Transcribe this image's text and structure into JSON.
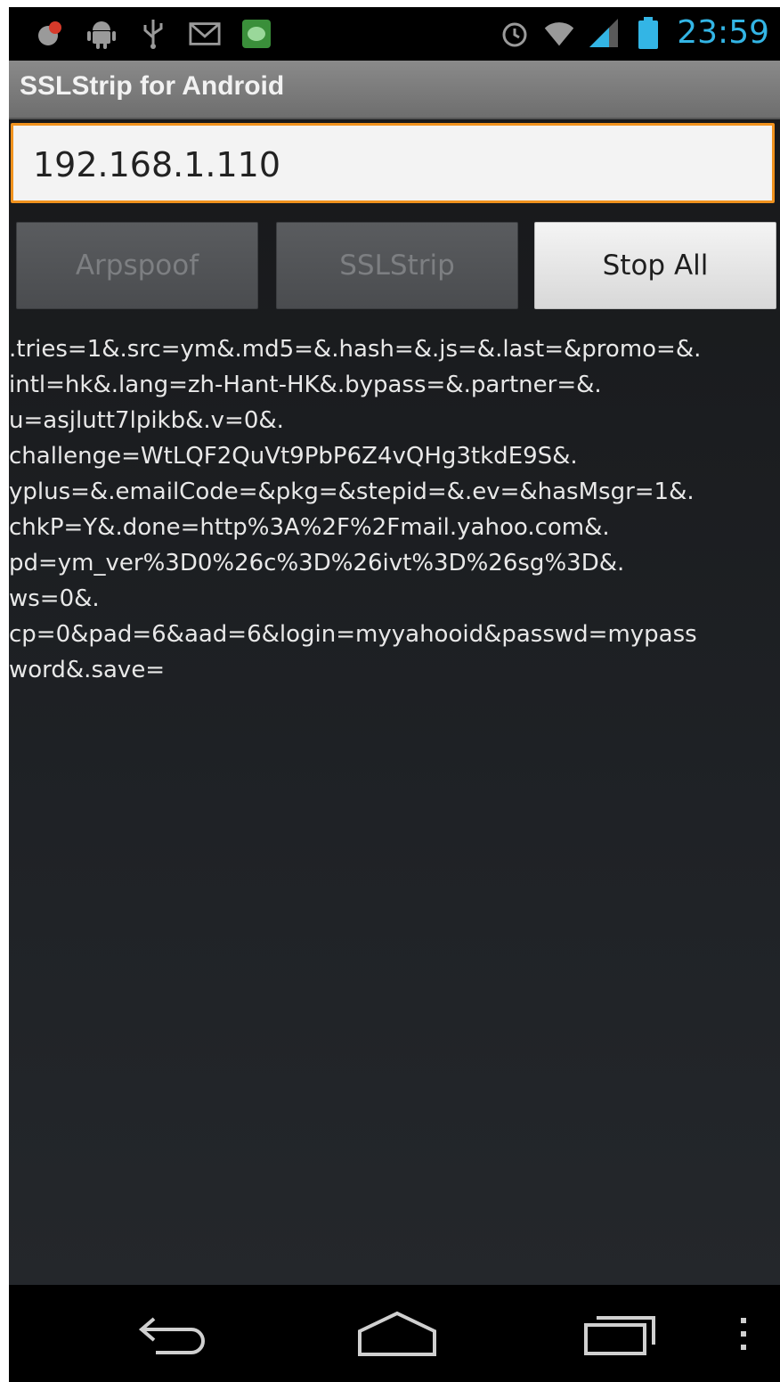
{
  "status_bar": {
    "time": "23:59",
    "time_color": "#33b5e5",
    "left_icons": [
      "alert-icon",
      "android-icon",
      "usb-icon",
      "gmail-icon",
      "chat-icon"
    ],
    "right_icons": [
      "alarm-icon",
      "wifi-icon",
      "signal-icon",
      "battery-icon"
    ]
  },
  "action_bar": {
    "title": "SSLStrip for Android"
  },
  "ip_field": {
    "value": "192.168.1.110",
    "accent": "#f0921e"
  },
  "buttons": {
    "arpspoof": "Arpspoof",
    "sslstrip": "SSLStrip",
    "stop_all": "Stop All"
  },
  "log_lines": [
    ".tries=1&.src=ym&.md5=&.hash=&.js=&.last=&promo=&.",
    "intl=hk&.lang=zh-Hant-HK&.bypass=&.partner=&.",
    "u=asjlutt7lpikb&.v=0&.",
    "challenge=WtLQF2QuVt9PbP6Z4vQHg3tkdE9S&.",
    "yplus=&.emailCode=&pkg=&stepid=&.ev=&hasMsgr=1&.",
    "chkP=Y&.done=http%3A%2F%2Fmail.yahoo.com&.",
    "pd=ym_ver%3D0%26c%3D%26ivt%3D%26sg%3D&.",
    "ws=0&.",
    "cp=0&pad=6&aad=6&login=myyahooid&passwd=mypass",
    "word&.save="
  ],
  "nav_bar": {
    "icons": [
      "back-icon",
      "home-icon",
      "recent-apps-icon",
      "overflow-menu-icon"
    ]
  }
}
